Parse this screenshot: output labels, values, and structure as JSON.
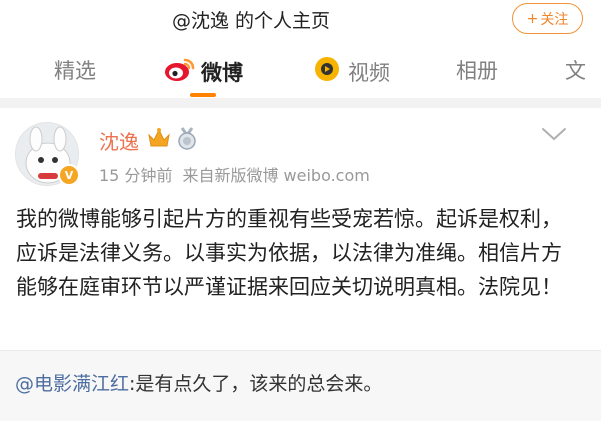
{
  "header": {
    "title": "@沈逸 的个人主页",
    "follow_label": "关注",
    "follow_plus": "+"
  },
  "tabs": [
    {
      "label": "精选",
      "icon": "none",
      "active": false
    },
    {
      "label": "微博",
      "icon": "weibo-icon",
      "active": true
    },
    {
      "label": "视频",
      "icon": "video-icon",
      "active": false
    },
    {
      "label": "相册",
      "icon": "none",
      "active": false
    },
    {
      "label": "文",
      "icon": "none",
      "active": false
    }
  ],
  "post": {
    "author": "沈逸",
    "time": "15 分钟前",
    "source": "来自新版微博 weibo.com",
    "content": "我的微博能够引起片方的重视有些受宠若惊。起诉是权利，应诉是法律义务。以事实为依据，以法律为准绳。相信片方能够在庭审环节以严谨证据来回应关切说明真相。法院见！"
  },
  "comment": {
    "mention": "@电影满江红",
    "text": ":是有点久了，该来的总会来。"
  },
  "colors": {
    "accent": "#ff8200",
    "username": "#eb7350",
    "mention": "#4e6ea0"
  }
}
